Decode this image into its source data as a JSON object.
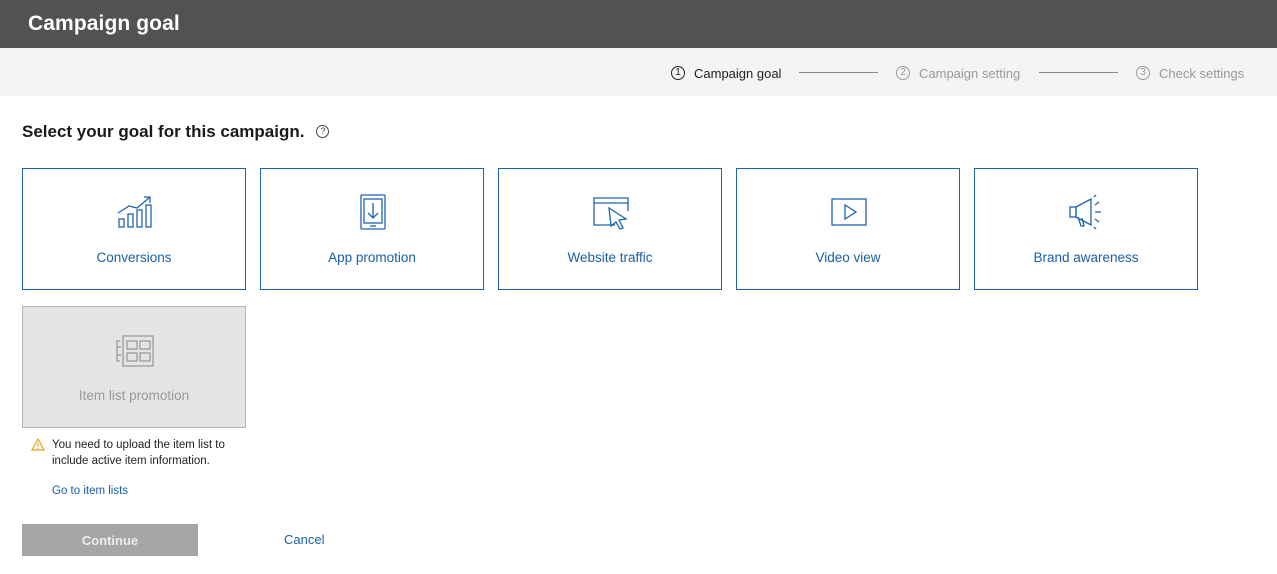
{
  "window": {
    "title": "Campaign goal"
  },
  "steps": [
    {
      "num": "1",
      "label": "Campaign goal",
      "state": "active"
    },
    {
      "num": "2",
      "label": "Campaign setting",
      "state": "inactive"
    },
    {
      "num": "3",
      "label": "Check settings",
      "state": "inactive"
    }
  ],
  "main": {
    "heading": "Select your goal for this campaign.",
    "help_glyph": "?"
  },
  "goals": [
    {
      "label": "Conversions",
      "icon": "bar-chart-trend-icon",
      "enabled": true
    },
    {
      "label": "App promotion",
      "icon": "mobile-download-icon",
      "enabled": true
    },
    {
      "label": "Website traffic",
      "icon": "browser-cursor-icon",
      "enabled": true
    },
    {
      "label": "Video view",
      "icon": "play-video-icon",
      "enabled": true
    },
    {
      "label": "Brand awareness",
      "icon": "megaphone-icon",
      "enabled": true
    },
    {
      "label": "Item list promotion",
      "icon": "item-grid-icon",
      "enabled": false
    }
  ],
  "warning": {
    "text": "You need to upload the item list to include active item information.",
    "link": "Go to item lists"
  },
  "actions": {
    "continue_label": "Continue",
    "cancel_label": "Cancel"
  },
  "colors": {
    "accent": "#1f64ad",
    "titlebar": "#525252",
    "disabled": "#a6a6a6",
    "warning": "#e3a21a"
  }
}
